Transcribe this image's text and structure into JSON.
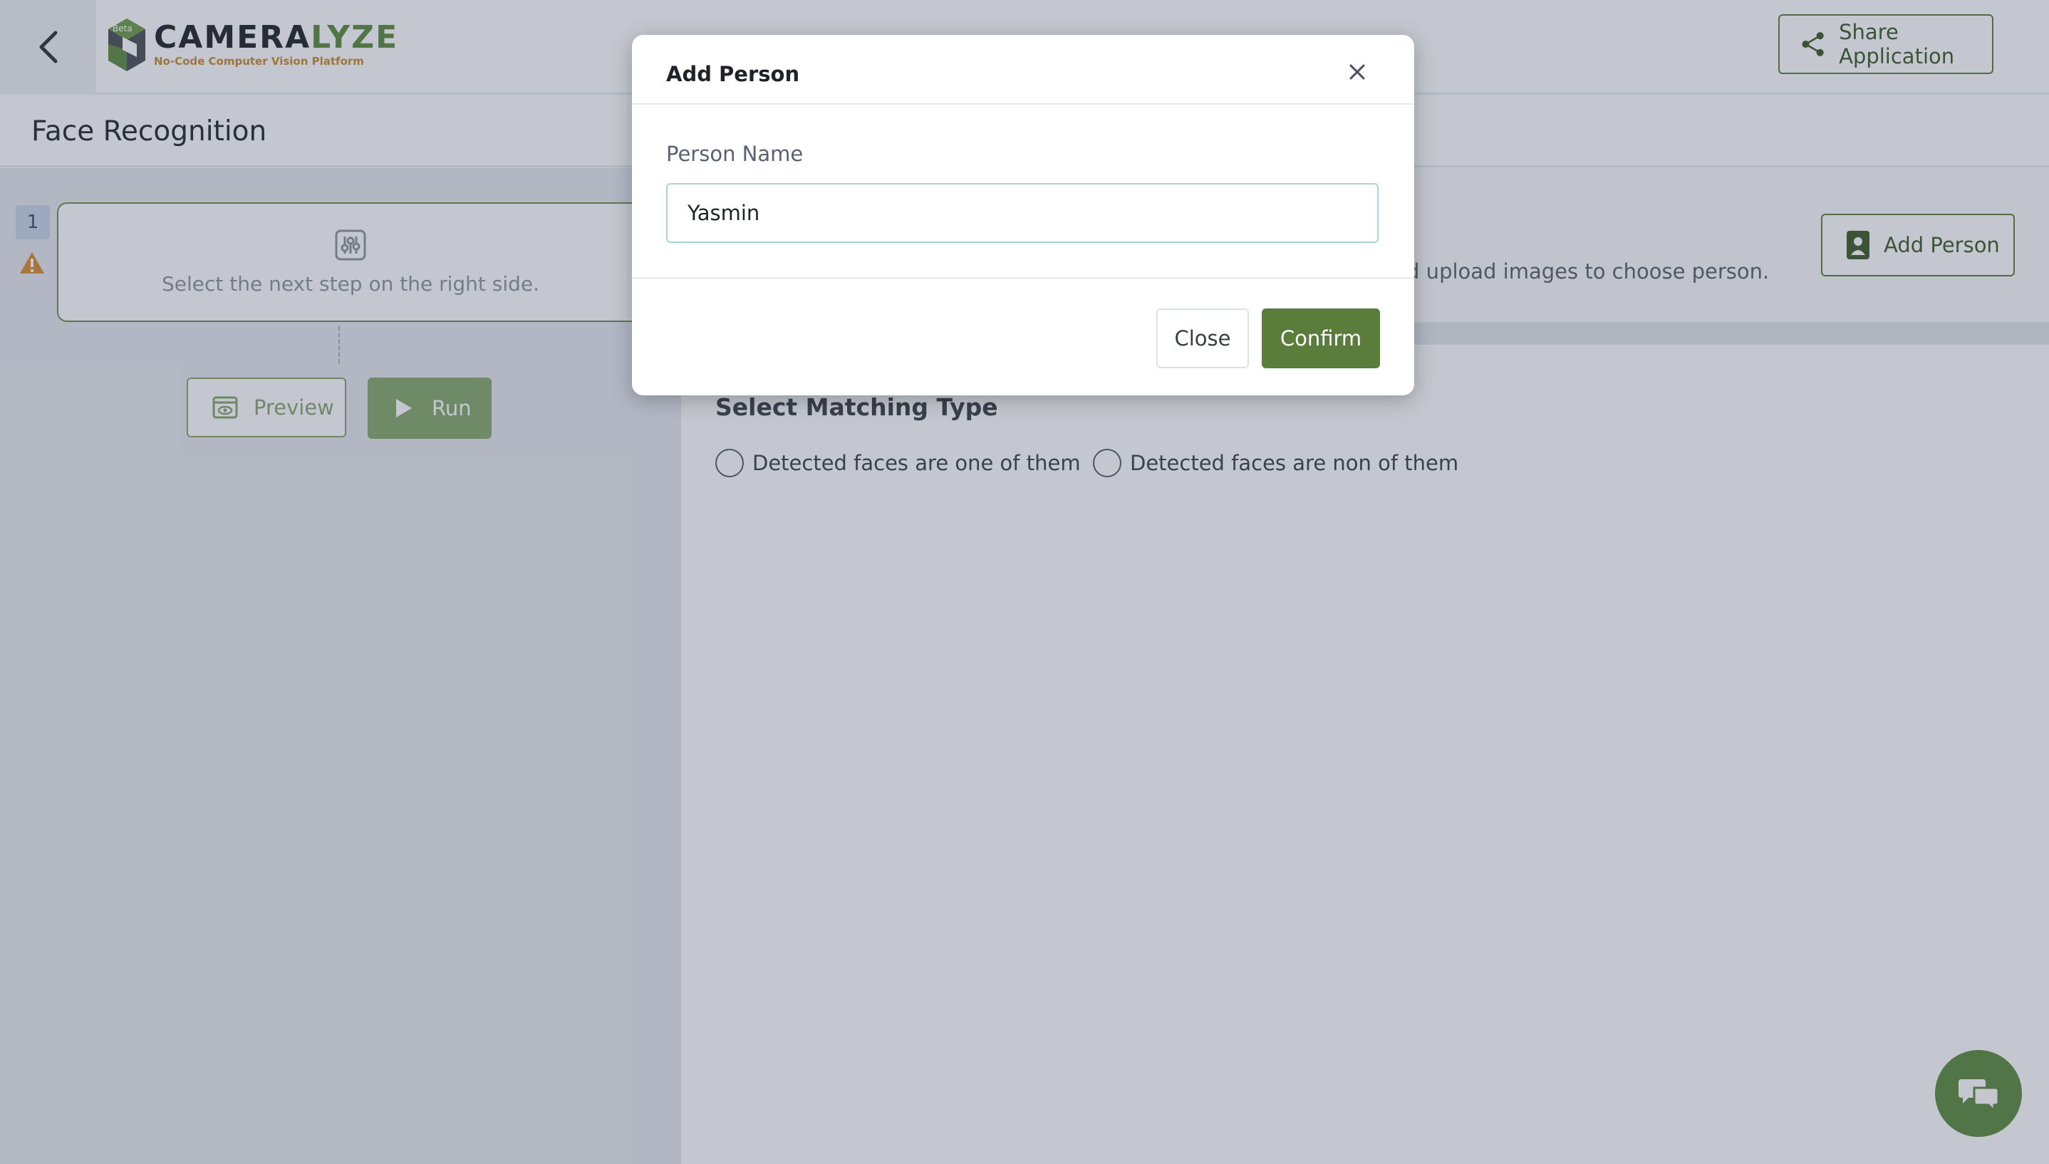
{
  "header": {
    "back_icon": "chevron-left-icon",
    "logo": {
      "name_part1": "CAMERA",
      "name_part2": "LYZE",
      "tagline": "No-Code Computer Vision Platform",
      "badge": "Beta"
    },
    "share_label": "Share Application",
    "share_icon": "share-icon"
  },
  "page": {
    "title": "Face Recognition"
  },
  "flow": {
    "step_number": "1",
    "warning_icon": "warning-icon",
    "step_hint": "Select the next step on the right side.",
    "step_icon": "sliders-icon",
    "preview_label": "Preview",
    "run_label": "Run"
  },
  "content": {
    "upload_hint": "ld upload images to choose person.",
    "add_person_label": "Add Person",
    "matching_title": "Select Matching Type",
    "matching_options": [
      {
        "label": "Detected faces are one of them",
        "selected": false
      },
      {
        "label": "Detected faces are non of them",
        "selected": false
      }
    ]
  },
  "modal": {
    "title": "Add Person",
    "field_label": "Person Name",
    "field_value": "Yasmin",
    "close_label": "Close",
    "confirm_label": "Confirm"
  },
  "colors": {
    "accent": "#5b7d3c",
    "brand_green": "#5b8a3c",
    "brand_orange": "#c98a2e",
    "warning": "#d98b2b",
    "input_focus": "#a9d6d9"
  }
}
